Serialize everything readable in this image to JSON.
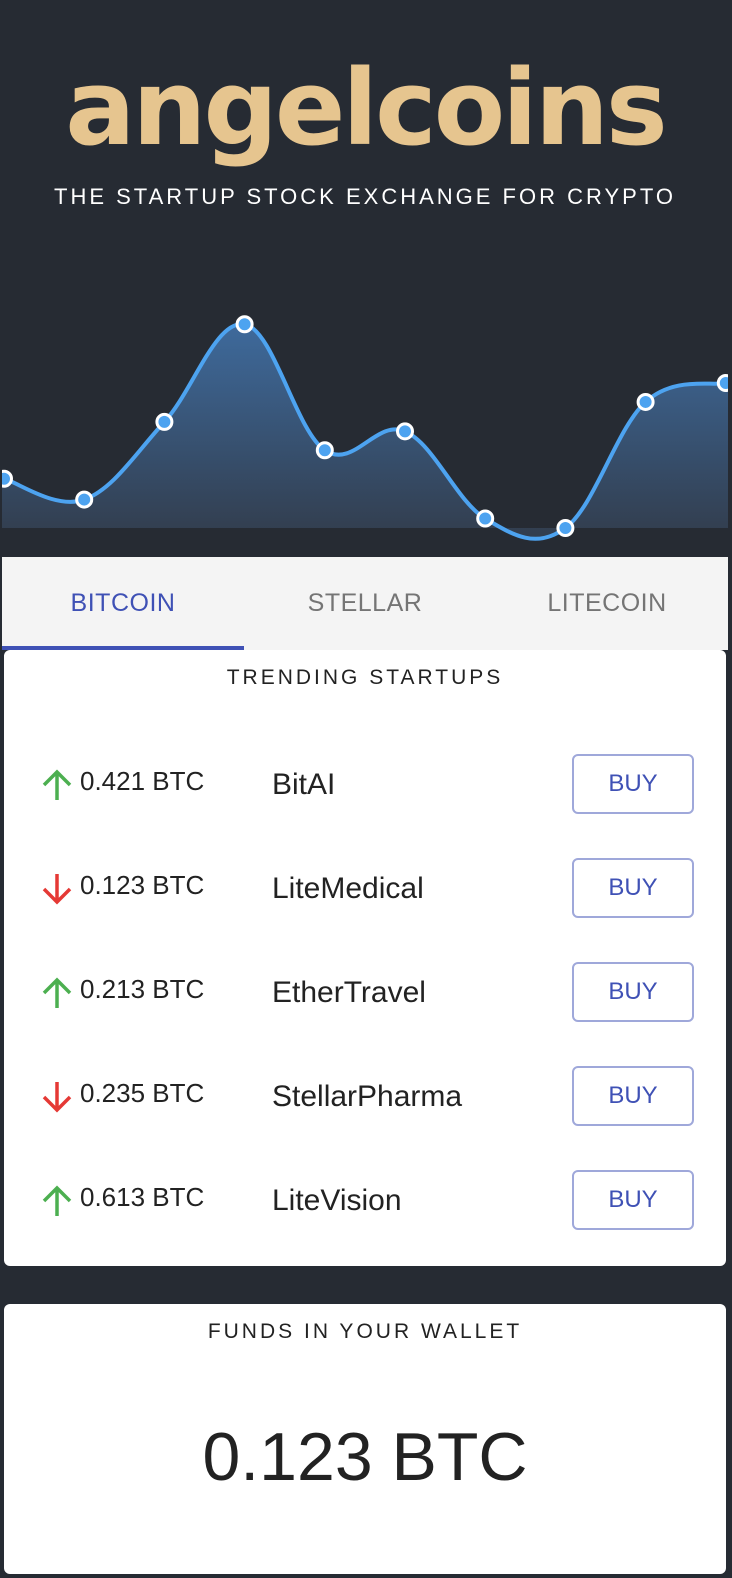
{
  "brand": {
    "logo_text": "angelcoins",
    "tagline": "THE STARTUP STOCK EXCHANGE FOR CRYPTO"
  },
  "chart_data": {
    "type": "area",
    "values": [
      52,
      30,
      112,
      215,
      82,
      102,
      10,
      0,
      133,
      153
    ],
    "ylim": [
      0,
      230
    ],
    "line_color": "#4da3f0",
    "point_fill": "#4da3f0",
    "point_stroke": "#ffffff",
    "grid": false,
    "title": "",
    "xlabel": "",
    "ylabel": ""
  },
  "tabs": [
    {
      "label": "BITCOIN",
      "active": true
    },
    {
      "label": "STELLAR",
      "active": false
    },
    {
      "label": "LITECOIN",
      "active": false
    }
  ],
  "trending": {
    "title": "TRENDING STARTUPS",
    "rows": [
      {
        "direction": "up",
        "price": "0.421 BTC",
        "name": "BitAI",
        "button": "BUY"
      },
      {
        "direction": "down",
        "price": "0.123 BTC",
        "name": "LiteMedical",
        "button": "BUY"
      },
      {
        "direction": "up",
        "price": "0.213 BTC",
        "name": "EtherTravel",
        "button": "BUY"
      },
      {
        "direction": "down",
        "price": "0.235 BTC",
        "name": "StellarPharma",
        "button": "BUY"
      },
      {
        "direction": "up",
        "price": "0.613 BTC",
        "name": "LiteVision",
        "button": "BUY"
      }
    ]
  },
  "wallet": {
    "title": "FUNDS IN YOUR WALLET",
    "amount": "0.123 BTC"
  },
  "colors": {
    "up": "#4caf50",
    "down": "#e53935",
    "accent": "#3f51b5",
    "brand": "#e6c58f"
  }
}
